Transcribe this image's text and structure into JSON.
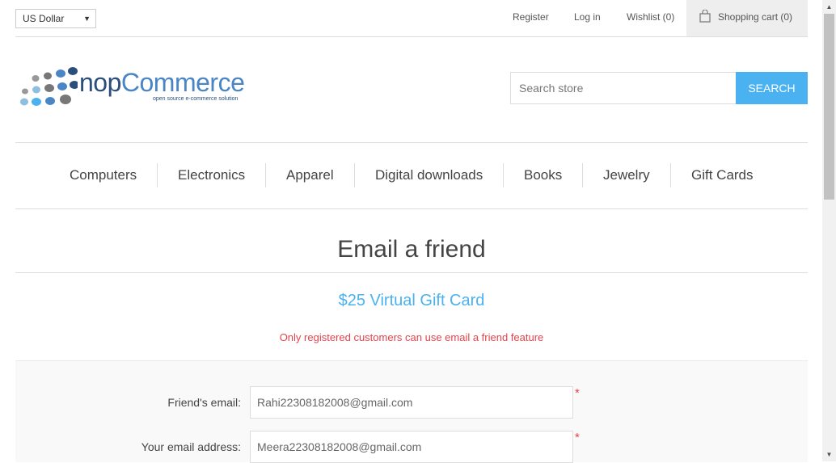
{
  "header": {
    "currency": "US Dollar",
    "register": "Register",
    "login": "Log in",
    "wishlist": "Wishlist (0)",
    "cart": "Shopping cart (0)"
  },
  "logo": {
    "brand_nop": "nop",
    "brand_commerce": "Commerce",
    "tagline": "open source e-commerce solution"
  },
  "search": {
    "placeholder": "Search store",
    "button": "SEARCH"
  },
  "menu": [
    "Computers",
    "Electronics",
    "Apparel",
    "Digital downloads",
    "Books",
    "Jewelry",
    "Gift Cards"
  ],
  "content": {
    "title": "Email a friend",
    "product": "$25 Virtual Gift Card",
    "error": "Only registered customers can use email a friend feature"
  },
  "form": {
    "friend_label": "Friend's email:",
    "friend_value": "Rahi22308182008@gmail.com",
    "your_label": "Your email address:",
    "your_value": "Meera22308182008@gmail.com",
    "required_mark": "*"
  },
  "colors": {
    "accent": "#4ab2f1",
    "error": "#e4434b"
  }
}
